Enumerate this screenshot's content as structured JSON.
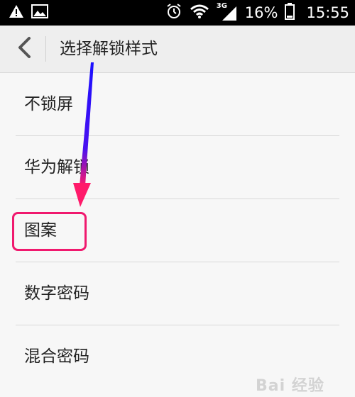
{
  "status_bar": {
    "network_label": "3G",
    "battery_percent": "16%",
    "time": "15:55",
    "left_icons": [
      "warning-icon",
      "image-icon"
    ],
    "right_icons": [
      "alarm-icon",
      "wifi-icon",
      "signal-icon",
      "battery-icon"
    ]
  },
  "header": {
    "title": "选择解锁样式",
    "back_icon": "chevron-left-icon"
  },
  "lock_options": [
    {
      "label": "不锁屏"
    },
    {
      "label": "华为解锁"
    },
    {
      "label": "图案"
    },
    {
      "label": "数字密码"
    },
    {
      "label": "混合密码"
    }
  ],
  "colors": {
    "highlight": "#f0196e",
    "arrow_start": "#1a10ff",
    "arrow_end": "#ff1a6a"
  },
  "watermark": {
    "text": "Bai 经验"
  }
}
